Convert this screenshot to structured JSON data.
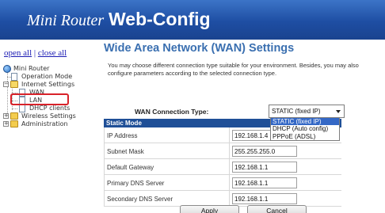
{
  "header": {
    "logo": "Mini Router",
    "title": "Web-Config"
  },
  "tree": {
    "open_all": "open all",
    "separator": "|",
    "close_all": "close all",
    "items": [
      {
        "label": "Mini Router",
        "icon": "globe-icon"
      },
      {
        "label": "Operation Mode",
        "icon": "page-icon"
      },
      {
        "label": "Internet Settings",
        "icon": "folder-open-icon"
      },
      {
        "label": "WAN",
        "icon": "page-icon",
        "selected": true
      },
      {
        "label": "LAN",
        "icon": "page-icon"
      },
      {
        "label": "DHCP clients",
        "icon": "page-icon"
      },
      {
        "label": "Wireless Settings",
        "icon": "folder-icon"
      },
      {
        "label": "Administration",
        "icon": "folder-icon"
      }
    ]
  },
  "main": {
    "title": "Wide Area Network (WAN) Settings",
    "description": "You may choose different connection type suitable for your environment. Besides, you may also configure parameters according to the selected connection type.",
    "connection_type_label": "WAN Connection Type:",
    "connection_type_value": "STATIC (fixed IP)",
    "connection_type_options": [
      "STATIC (fixed IP)",
      "DHCP (Auto config)",
      "PPPoE (ADSL)"
    ],
    "table_header": "Static Mode",
    "fields": [
      {
        "label": "IP Address",
        "value": "192.168.1.4"
      },
      {
        "label": "Subnet Mask",
        "value": "255.255.255.0"
      },
      {
        "label": "Default Gateway",
        "value": "192.168.1.1"
      },
      {
        "label": "Primary DNS Server",
        "value": "192.168.1.1"
      },
      {
        "label": "Secondary DNS Server",
        "value": "192.168.1.1"
      }
    ],
    "apply_label": "Apply",
    "cancel_label": "Cancel"
  },
  "colors": {
    "header": "#1e4ea3",
    "title": "#3a6fb0",
    "table_header": "#1f4f97",
    "selection": "#3468c6",
    "highlight": "#d8222a"
  }
}
